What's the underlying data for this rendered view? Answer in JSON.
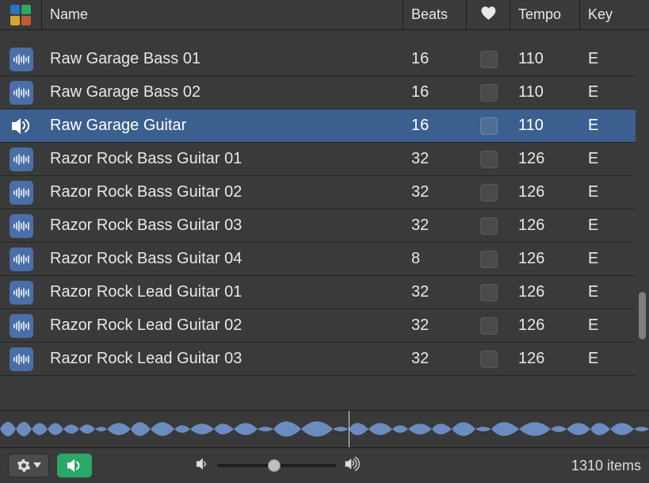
{
  "columns": {
    "name": "Name",
    "beats": "Beats",
    "tempo": "Tempo",
    "key": "Key"
  },
  "rows": [
    {
      "name": "Raw Garage Bass 01",
      "beats": "16",
      "tempo": "110",
      "key": "E",
      "selected": false
    },
    {
      "name": "Raw Garage Bass 02",
      "beats": "16",
      "tempo": "110",
      "key": "E",
      "selected": false
    },
    {
      "name": "Raw Garage Guitar",
      "beats": "16",
      "tempo": "110",
      "key": "E",
      "selected": true
    },
    {
      "name": "Razor Rock Bass Guitar 01",
      "beats": "32",
      "tempo": "126",
      "key": "E",
      "selected": false
    },
    {
      "name": "Razor Rock Bass Guitar 02",
      "beats": "32",
      "tempo": "126",
      "key": "E",
      "selected": false
    },
    {
      "name": "Razor Rock Bass Guitar 03",
      "beats": "32",
      "tempo": "126",
      "key": "E",
      "selected": false
    },
    {
      "name": "Razor Rock Bass Guitar 04",
      "beats": "8",
      "tempo": "126",
      "key": "E",
      "selected": false
    },
    {
      "name": "Razor Rock Lead Guitar 01",
      "beats": "32",
      "tempo": "126",
      "key": "E",
      "selected": false
    },
    {
      "name": "Razor Rock Lead Guitar 02",
      "beats": "32",
      "tempo": "126",
      "key": "E",
      "selected": false
    },
    {
      "name": "Razor Rock Lead Guitar 03",
      "beats": "32",
      "tempo": "126",
      "key": "E",
      "selected": false
    }
  ],
  "footer": {
    "item_count": "1310 items"
  }
}
